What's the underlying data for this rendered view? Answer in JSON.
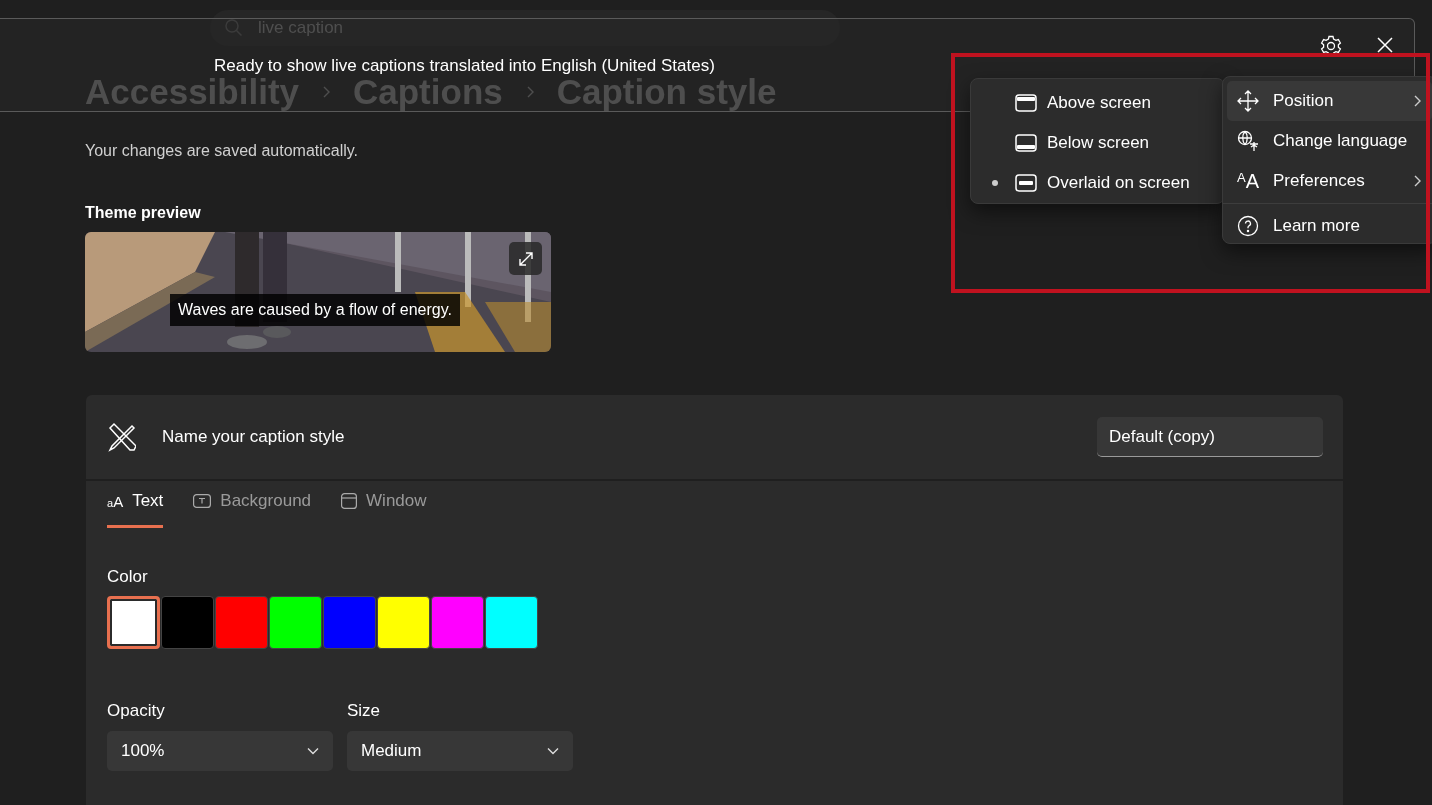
{
  "search": {
    "value": "live caption"
  },
  "breadcrumb": [
    "Accessibility",
    "Captions",
    "Caption style"
  ],
  "live_caption": {
    "text": "Ready to show live captions translated into English (United States)"
  },
  "position_menu": {
    "items": [
      {
        "label": "Above screen",
        "kind": "above",
        "selected": false
      },
      {
        "label": "Below screen",
        "kind": "below",
        "selected": false
      },
      {
        "label": "Overlaid on screen",
        "kind": "overlaid",
        "selected": true
      }
    ]
  },
  "main_menu": {
    "items": [
      {
        "label": "Position",
        "kind": "position",
        "selected": true,
        "has_submenu": true
      },
      {
        "label": "Change language",
        "kind": "language",
        "selected": false,
        "has_submenu": false
      },
      {
        "label": "Preferences",
        "kind": "preferences",
        "icon_text": "AA",
        "selected": false,
        "has_submenu": true
      },
      {
        "label": "Learn more",
        "kind": "help",
        "selected": false,
        "has_submenu": false
      }
    ]
  },
  "note": "Your changes are saved automatically.",
  "preview": {
    "title": "Theme preview",
    "caption": "Waves are caused by a flow of energy."
  },
  "style_card": {
    "name_label": "Name your caption style",
    "name_value": "Default (copy)",
    "tabs": [
      {
        "label": "Text",
        "kind": "text",
        "icon_text": "aA",
        "selected": true
      },
      {
        "label": "Background",
        "kind": "background",
        "selected": false
      },
      {
        "label": "Window",
        "kind": "window",
        "selected": false
      }
    ],
    "color": {
      "label": "Color",
      "swatches": [
        {
          "color": "#ffffff",
          "selected": true
        },
        {
          "color": "#000000",
          "selected": false
        },
        {
          "color": "#ff0000",
          "selected": false
        },
        {
          "color": "#00ff00",
          "selected": false
        },
        {
          "color": "#0000ff",
          "selected": false
        },
        {
          "color": "#ffff00",
          "selected": false
        },
        {
          "color": "#ff00ff",
          "selected": false
        },
        {
          "color": "#00ffff",
          "selected": false
        }
      ]
    },
    "opacity": {
      "label": "Opacity",
      "value": "100%"
    },
    "size": {
      "label": "Size",
      "value": "Medium"
    }
  }
}
